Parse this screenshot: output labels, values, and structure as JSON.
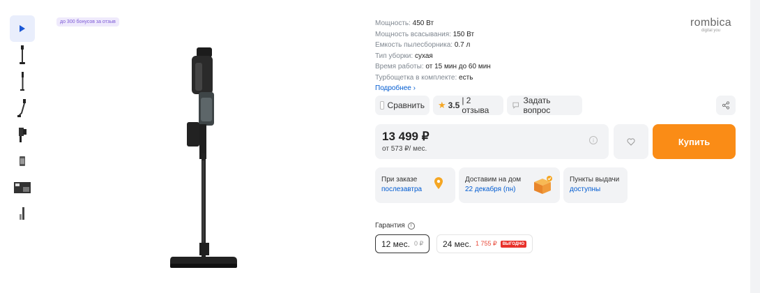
{
  "bonus_label": "до 300 бонусов за отзыв",
  "thumbnails": [
    {
      "name": "video",
      "active": true
    },
    {
      "name": "front"
    },
    {
      "name": "side"
    },
    {
      "name": "angled"
    },
    {
      "name": "handheld"
    },
    {
      "name": "dustbin"
    },
    {
      "name": "kit"
    },
    {
      "name": "accessories"
    }
  ],
  "specs": [
    {
      "label": "Мощность:",
      "value": "450 Вт"
    },
    {
      "label": "Мощность всасывания:",
      "value": "150 Вт"
    },
    {
      "label": "Емкость пылесборника:",
      "value": "0.7 л"
    },
    {
      "label": "Тип уборки:",
      "value": "сухая"
    },
    {
      "label": "Время работы:",
      "value": "от 15 мин до 60 мин"
    },
    {
      "label": "Турбощетка в комплекте:",
      "value": "есть"
    }
  ],
  "more_link": "Подробнее ›",
  "brand": {
    "name": "rombica",
    "tagline": "digital you"
  },
  "actions": {
    "compare": "Сравнить",
    "rating": "3.5",
    "reviews": "| 2 отзыва",
    "ask": "Задать вопрос"
  },
  "price": {
    "value": "13 499 ₽",
    "installment": "от 573 ₽/ мес."
  },
  "buy_label": "Купить",
  "delivery": [
    {
      "title": "При заказе",
      "link": "послезавтра"
    },
    {
      "title": "Доставим на дом",
      "link": "22 декабря (пн)"
    },
    {
      "title": "Пункты выдачи",
      "link": "доступны"
    }
  ],
  "warranty": {
    "label": "Гарантия",
    "options": [
      {
        "term": "12 мес.",
        "price": "0 ₽",
        "selected": true
      },
      {
        "term": "24 мес.",
        "price": "1 755 ₽",
        "badge": "ВЫГОДНО",
        "selected": false
      }
    ]
  },
  "colors": {
    "accent": "#fa8c16",
    "link": "#005bd1",
    "badge": "#e8312a",
    "star": "#f5a623"
  }
}
